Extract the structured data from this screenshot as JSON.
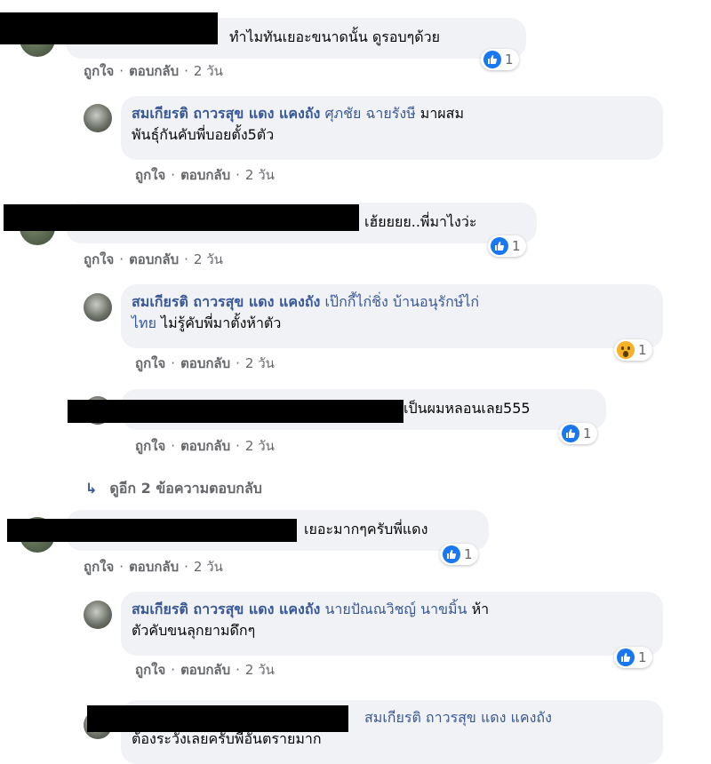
{
  "actions": {
    "like": "ถูกใจ",
    "reply": "ตอบกลับ",
    "sep": "·",
    "time": "2 วัน"
  },
  "comments": [
    {
      "text": "ทำไมทันเยอะขนาดนั้น ดูรอบๆด้วย",
      "reaction": "like",
      "count": "1"
    },
    {
      "name": "สมเกียรติ ถาวรสุข แดง แคงถัง",
      "tag": "ศุภชัย ฉายรังษี",
      "line1": "มาผสม",
      "line2": "พันธุ์กันคับพี่บอยตั้ง5ตัว"
    },
    {
      "text": "เฮ้ยยยย..พี่มาไงว่ะ",
      "reaction": "like",
      "count": "1"
    },
    {
      "name": "สมเกียรติ ถาวรสุข แดง แคงถัง",
      "tag": "เป๊กกี้ไก่ชิ่ง บ้านอนุรักษ์ไก่",
      "tag2": "ไทย",
      "line2": "ไม่รู้คับพี่มาตั้งห้าตัว",
      "reaction": "wow",
      "count": "1"
    },
    {
      "text": "เป็นผมหลอนเลย555",
      "reaction": "like",
      "count": "1"
    },
    {
      "text": "เยอะมากๆครับพี่แดง",
      "reaction": "like",
      "count": "1"
    },
    {
      "name": "สมเกียรติ ถาวรสุข แดง แคงถัง",
      "tag": "นายปัณณวิชญ์ นาขมิ้น",
      "line1": "ห้า",
      "line2": "ตัวคับขนลุกยามดึกๆ",
      "reaction": "like",
      "count": "1"
    },
    {
      "tag": "สมเกียรติ ถาวรสุข แดง แคงถัง",
      "line2": "ต้องระวังเลยครับพี่อันตรายมาก"
    }
  ],
  "more_replies": "ดูอีก 2 ข้อความตอบกลับ",
  "icons": {
    "like": "thumbs-up-icon",
    "wow": "wow-face-icon",
    "reply_arrow": "reply-arrow-icon"
  },
  "colors": {
    "link": "#385898",
    "bubble": "#f0f2f5",
    "like_blue": "#1877f2",
    "meta": "#65676b"
  }
}
